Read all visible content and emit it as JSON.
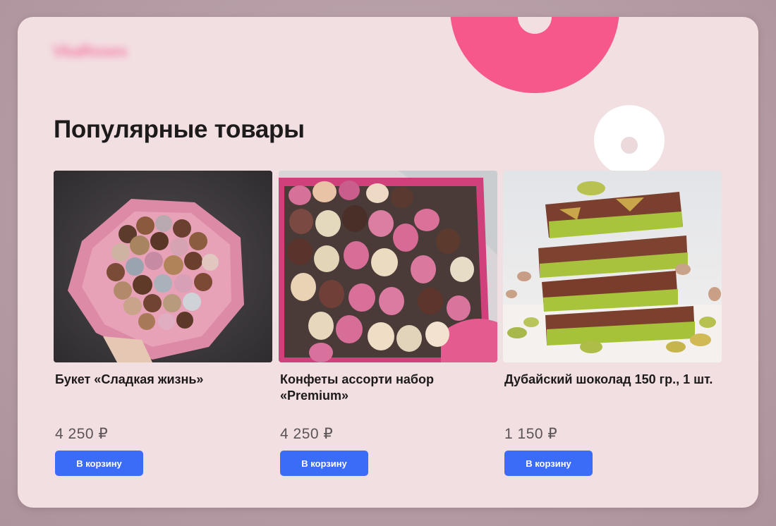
{
  "header": {
    "logo_text": "VkaRoses",
    "title": "Популярные товары"
  },
  "products": [
    {
      "name": "Букет «Сладкая жизнь»",
      "price": "4 250 ₽",
      "button_label": "В корзину"
    },
    {
      "name": "Конфеты ассорти набор «Premium»",
      "price": "4 250 ₽",
      "button_label": "В корзину"
    },
    {
      "name": "Дубайский шоколад 150 гр., 1 шт.",
      "price": "1 150 ₽",
      "button_label": "В корзину"
    }
  ],
  "colors": {
    "card_background": "#f2dfe2",
    "accent_pink": "#f7588c",
    "button_blue": "#3b6cf7"
  }
}
